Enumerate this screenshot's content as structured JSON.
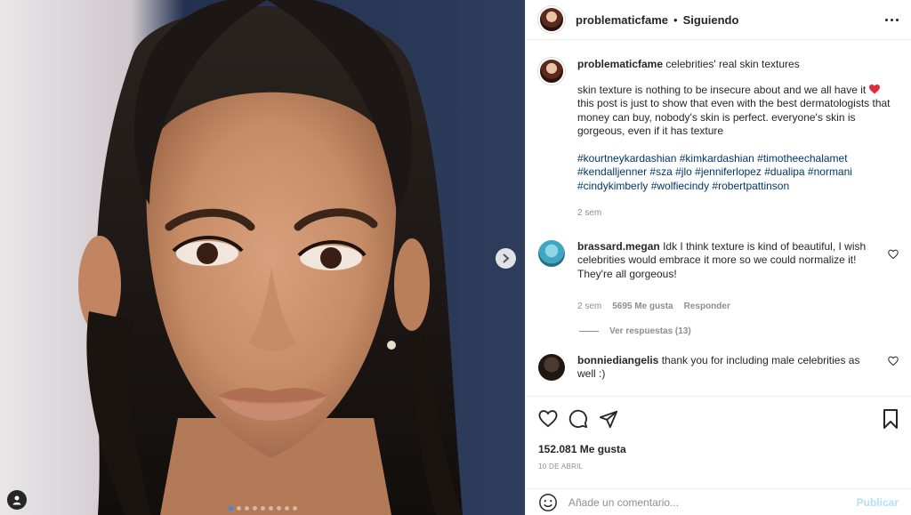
{
  "header": {
    "username": "problematicfame",
    "separator": "•",
    "follow_status": "Siguiendo"
  },
  "caption": {
    "username": "problematicfame",
    "title": "celebrities' real skin textures",
    "body": "skin texture is nothing to be insecure about and we all have it",
    "body2": "this post is just to show that even with the best dermatologists that money can buy, nobody's skin is perfect. everyone's skin is gorgeous, even if it has texture",
    "hashtags": [
      "#kourtneykardashian",
      "#kimkardashian",
      "#timotheechalamet",
      "#kendalljenner",
      "#sza",
      "#jlo",
      "#jenniferlopez",
      "#dualipa",
      "#normani",
      "#cindykimberly",
      "#wolfiecindy",
      "#robertpattinson"
    ],
    "time": "2 sem"
  },
  "comments": [
    {
      "username": "brassard.megan",
      "text": "Idk I think texture is kind of beautiful, I wish celebrities would embrace it more so we could normalize it! They're all gorgeous!",
      "time": "2 sem",
      "likes": "5695 Me gusta",
      "reply": "Responder",
      "view_replies": "Ver respuestas (13)"
    },
    {
      "username": "bonniediangelis",
      "text": "thank you for including male celebrities as well :)"
    }
  ],
  "stats": {
    "likes": "152.081 Me gusta",
    "date": "10 DE ABRIL"
  },
  "composer": {
    "placeholder": "Añade un comentario...",
    "publish": "Publicar"
  },
  "carousel": {
    "count": 9,
    "active_index": 0
  },
  "colors": {
    "link": "#00376b",
    "heart": "#ed4956",
    "publish_disabled": "#b2dffc",
    "active_dot": "#2b8cf5"
  },
  "icons": [
    "next-arrow-icon",
    "user-tag-icon",
    "more-options-icon",
    "heart-icon",
    "comment-icon",
    "share-icon",
    "bookmark-icon",
    "emoji-icon"
  ]
}
